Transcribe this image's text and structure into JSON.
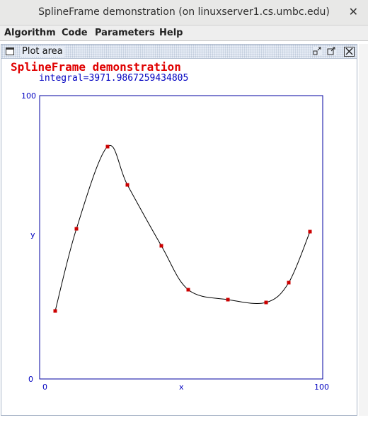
{
  "window": {
    "title": "SplineFrame demonstration (on linuxserver1.cs.umbc.edu)",
    "close_glyph": "✕"
  },
  "menu": {
    "items": [
      "Algorithm",
      "Code",
      "Parameters",
      "Help"
    ]
  },
  "internal_frame": {
    "title": "Plot area",
    "icons": [
      "frame-icon",
      "iconify-icon",
      "maximize-icon",
      "close-icon"
    ]
  },
  "plot": {
    "heading": "SplineFrame demonstration",
    "integral_text": "integral=3971.9867259434805",
    "heading_color": "#e00000",
    "axis_color": "#0000c0",
    "point_color": "#cc0000"
  },
  "chart_data": {
    "type": "line",
    "title": "SplineFrame demonstration",
    "subtitle": "integral=3971.9867259434805",
    "xlabel": "x",
    "ylabel": "y",
    "xlim": [
      0,
      100
    ],
    "ylim": [
      0,
      100
    ],
    "x_tick_labels": [
      "0",
      "100"
    ],
    "y_tick_labels": [
      "0",
      "100"
    ],
    "grid": false,
    "series": [
      {
        "points": [
          {
            "x": 5.5,
            "y": 24
          },
          {
            "x": 13,
            "y": 53
          },
          {
            "x": 24,
            "y": 82
          },
          {
            "x": 31,
            "y": 68.5
          },
          {
            "x": 43,
            "y": 47
          },
          {
            "x": 52.5,
            "y": 31.5
          },
          {
            "x": 66.5,
            "y": 28
          },
          {
            "x": 80,
            "y": 27
          },
          {
            "x": 88,
            "y": 34
          },
          {
            "x": 95.5,
            "y": 52
          }
        ]
      }
    ]
  }
}
